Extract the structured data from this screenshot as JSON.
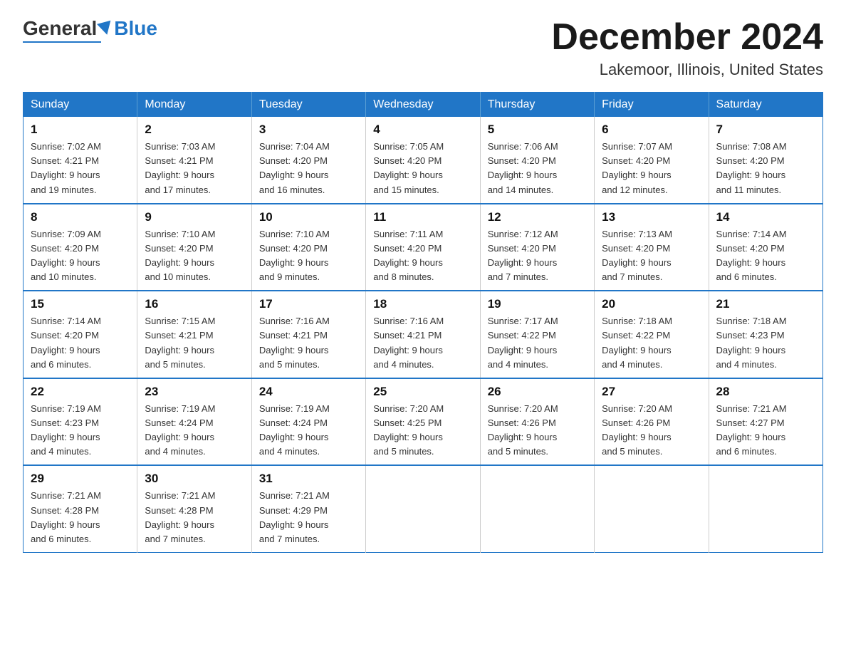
{
  "logo": {
    "general": "General",
    "blue": "Blue"
  },
  "header": {
    "month_title": "December 2024",
    "location": "Lakemoor, Illinois, United States"
  },
  "weekdays": [
    "Sunday",
    "Monday",
    "Tuesday",
    "Wednesday",
    "Thursday",
    "Friday",
    "Saturday"
  ],
  "weeks": [
    [
      {
        "day": "1",
        "sunrise": "7:02 AM",
        "sunset": "4:21 PM",
        "daylight": "9 hours and 19 minutes."
      },
      {
        "day": "2",
        "sunrise": "7:03 AM",
        "sunset": "4:21 PM",
        "daylight": "9 hours and 17 minutes."
      },
      {
        "day": "3",
        "sunrise": "7:04 AM",
        "sunset": "4:20 PM",
        "daylight": "9 hours and 16 minutes."
      },
      {
        "day": "4",
        "sunrise": "7:05 AM",
        "sunset": "4:20 PM",
        "daylight": "9 hours and 15 minutes."
      },
      {
        "day": "5",
        "sunrise": "7:06 AM",
        "sunset": "4:20 PM",
        "daylight": "9 hours and 14 minutes."
      },
      {
        "day": "6",
        "sunrise": "7:07 AM",
        "sunset": "4:20 PM",
        "daylight": "9 hours and 12 minutes."
      },
      {
        "day": "7",
        "sunrise": "7:08 AM",
        "sunset": "4:20 PM",
        "daylight": "9 hours and 11 minutes."
      }
    ],
    [
      {
        "day": "8",
        "sunrise": "7:09 AM",
        "sunset": "4:20 PM",
        "daylight": "9 hours and 10 minutes."
      },
      {
        "day": "9",
        "sunrise": "7:10 AM",
        "sunset": "4:20 PM",
        "daylight": "9 hours and 10 minutes."
      },
      {
        "day": "10",
        "sunrise": "7:10 AM",
        "sunset": "4:20 PM",
        "daylight": "9 hours and 9 minutes."
      },
      {
        "day": "11",
        "sunrise": "7:11 AM",
        "sunset": "4:20 PM",
        "daylight": "9 hours and 8 minutes."
      },
      {
        "day": "12",
        "sunrise": "7:12 AM",
        "sunset": "4:20 PM",
        "daylight": "9 hours and 7 minutes."
      },
      {
        "day": "13",
        "sunrise": "7:13 AM",
        "sunset": "4:20 PM",
        "daylight": "9 hours and 7 minutes."
      },
      {
        "day": "14",
        "sunrise": "7:14 AM",
        "sunset": "4:20 PM",
        "daylight": "9 hours and 6 minutes."
      }
    ],
    [
      {
        "day": "15",
        "sunrise": "7:14 AM",
        "sunset": "4:20 PM",
        "daylight": "9 hours and 6 minutes."
      },
      {
        "day": "16",
        "sunrise": "7:15 AM",
        "sunset": "4:21 PM",
        "daylight": "9 hours and 5 minutes."
      },
      {
        "day": "17",
        "sunrise": "7:16 AM",
        "sunset": "4:21 PM",
        "daylight": "9 hours and 5 minutes."
      },
      {
        "day": "18",
        "sunrise": "7:16 AM",
        "sunset": "4:21 PM",
        "daylight": "9 hours and 4 minutes."
      },
      {
        "day": "19",
        "sunrise": "7:17 AM",
        "sunset": "4:22 PM",
        "daylight": "9 hours and 4 minutes."
      },
      {
        "day": "20",
        "sunrise": "7:18 AM",
        "sunset": "4:22 PM",
        "daylight": "9 hours and 4 minutes."
      },
      {
        "day": "21",
        "sunrise": "7:18 AM",
        "sunset": "4:23 PM",
        "daylight": "9 hours and 4 minutes."
      }
    ],
    [
      {
        "day": "22",
        "sunrise": "7:19 AM",
        "sunset": "4:23 PM",
        "daylight": "9 hours and 4 minutes."
      },
      {
        "day": "23",
        "sunrise": "7:19 AM",
        "sunset": "4:24 PM",
        "daylight": "9 hours and 4 minutes."
      },
      {
        "day": "24",
        "sunrise": "7:19 AM",
        "sunset": "4:24 PM",
        "daylight": "9 hours and 4 minutes."
      },
      {
        "day": "25",
        "sunrise": "7:20 AM",
        "sunset": "4:25 PM",
        "daylight": "9 hours and 5 minutes."
      },
      {
        "day": "26",
        "sunrise": "7:20 AM",
        "sunset": "4:26 PM",
        "daylight": "9 hours and 5 minutes."
      },
      {
        "day": "27",
        "sunrise": "7:20 AM",
        "sunset": "4:26 PM",
        "daylight": "9 hours and 5 minutes."
      },
      {
        "day": "28",
        "sunrise": "7:21 AM",
        "sunset": "4:27 PM",
        "daylight": "9 hours and 6 minutes."
      }
    ],
    [
      {
        "day": "29",
        "sunrise": "7:21 AM",
        "sunset": "4:28 PM",
        "daylight": "9 hours and 6 minutes."
      },
      {
        "day": "30",
        "sunrise": "7:21 AM",
        "sunset": "4:28 PM",
        "daylight": "9 hours and 7 minutes."
      },
      {
        "day": "31",
        "sunrise": "7:21 AM",
        "sunset": "4:29 PM",
        "daylight": "9 hours and 7 minutes."
      },
      null,
      null,
      null,
      null
    ]
  ]
}
